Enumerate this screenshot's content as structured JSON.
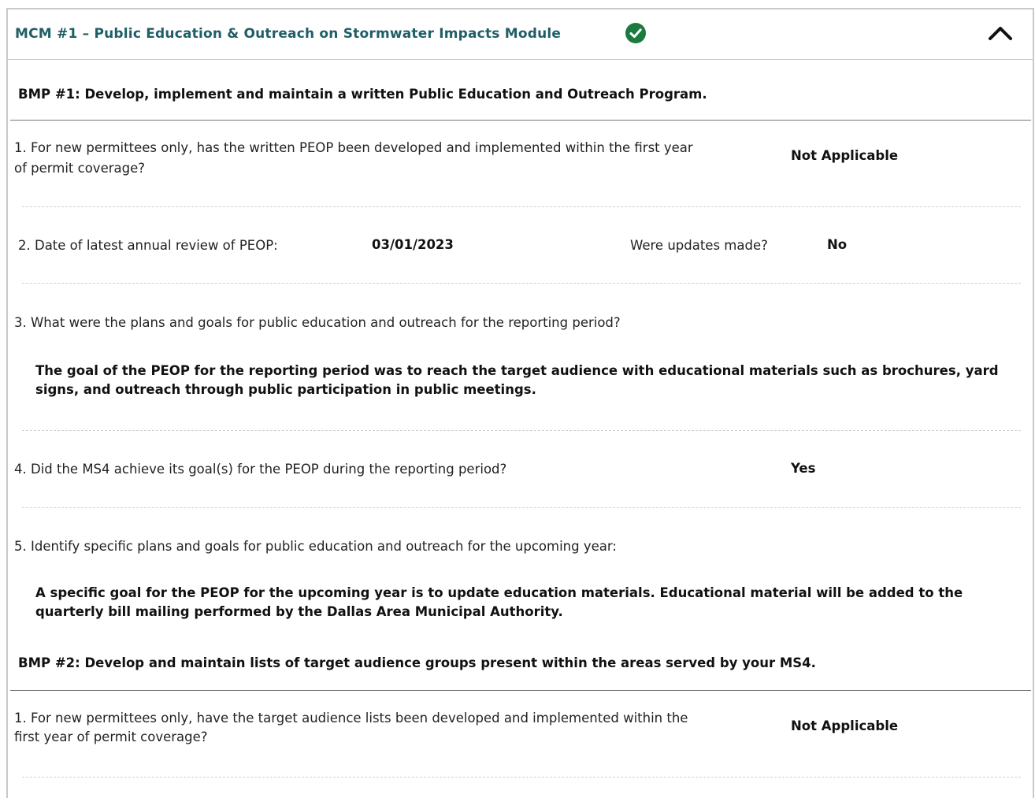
{
  "module": {
    "title": "MCM #1 – Public Education & Outreach on Stormwater Impacts Module",
    "status_icon": "check-circle-icon",
    "status_color": "#1b7a3e",
    "title_color": "#1f5e66",
    "toggle_icon": "chevron-up-icon"
  },
  "bmp1": {
    "heading": "BMP #1: Develop, implement and maintain a written Public Education and Outreach Program.",
    "q1": {
      "line1": "1. For new permittees only, has the written PEOP been developed and implemented within the first year",
      "line2": "of permit coverage?",
      "answer": "Not Applicable"
    },
    "q2": {
      "label": "2. Date of latest annual review of PEOP:",
      "date": "03/01/2023",
      "updates_label": "Were updates made?",
      "updates_answer": "No"
    },
    "q3": {
      "label": "3. What were the plans and goals for public education and outreach for the reporting period?",
      "answer": "The goal of the PEOP for the reporting period was to reach the target audience with educational materials such as brochures, yard signs, and outreach through public participation in public meetings."
    },
    "q4": {
      "label": "4. Did the MS4 achieve its goal(s) for the PEOP during the reporting period?",
      "answer": "Yes"
    },
    "q5": {
      "label": "5. Identify specific plans and goals for public education and outreach for the upcoming year:",
      "answer": "A specific goal for the PEOP for the upcoming year is to update education materials. Educational material will be added to the quarterly bill mailing performed by the Dallas Area Municipal Authority."
    }
  },
  "bmp2": {
    "heading": "BMP #2: Develop and maintain lists of target audience groups present within the areas served by your MS4.",
    "q1": {
      "line1": "1. For new permittees only, have the target audience lists been developed and implemented within the",
      "line2": "first year of permit coverage?",
      "answer": "Not Applicable"
    }
  }
}
